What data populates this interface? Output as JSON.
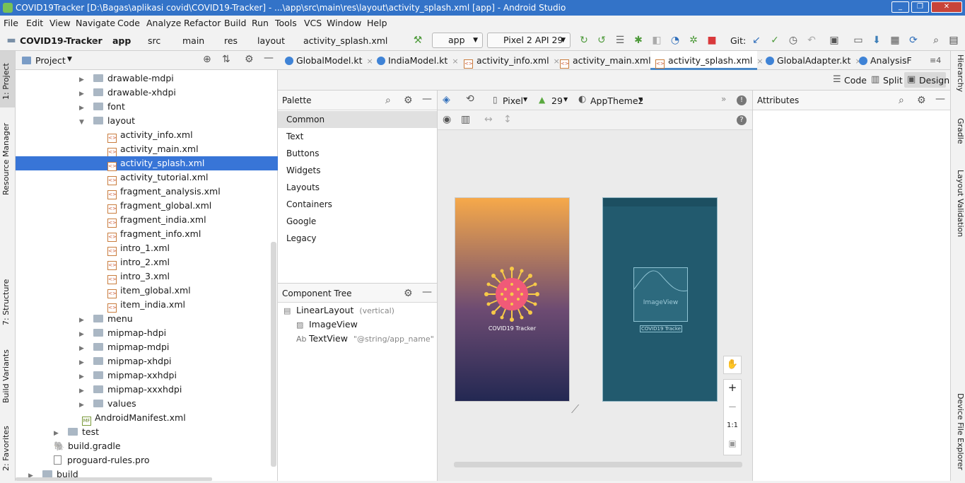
{
  "window": {
    "title": "COVID19Tracker [D:\\Bagas\\aplikasi covid\\COVID19-Tracker] - ...\\app\\src\\main\\res\\layout\\activity_splash.xml [app] - Android Studio"
  },
  "menu": [
    "File",
    "Edit",
    "View",
    "Navigate",
    "Code",
    "Analyze",
    "Refactor",
    "Build",
    "Run",
    "Tools",
    "VCS",
    "Window",
    "Help"
  ],
  "breadcrumb": [
    "COVID19-Tracker",
    "app",
    "src",
    "main",
    "res",
    "layout",
    "activity_splash.xml"
  ],
  "toolbar": {
    "run_config": "app",
    "device": "Pixel 2 API 29",
    "git_label": "Git:"
  },
  "left_tabs": [
    "1: Project",
    "Resource Manager",
    "7: Structure",
    "Build Variants",
    "2: Favorites"
  ],
  "right_tabs": [
    "Hierarchy",
    "Gradle",
    "Layout Validation",
    "Device File Explorer"
  ],
  "project": {
    "header": "Project",
    "tree": [
      {
        "label": "drawable-mdpi",
        "type": "folder",
        "level": 1,
        "expanded": false
      },
      {
        "label": "drawable-xhdpi",
        "type": "folder",
        "level": 1,
        "expanded": false
      },
      {
        "label": "font",
        "type": "folder",
        "level": 1,
        "expanded": false
      },
      {
        "label": "layout",
        "type": "folder",
        "level": 1,
        "expanded": true
      },
      {
        "label": "activity_info.xml",
        "type": "xml",
        "level": 2
      },
      {
        "label": "activity_main.xml",
        "type": "xml",
        "level": 2
      },
      {
        "label": "activity_splash.xml",
        "type": "xml",
        "level": 2,
        "selected": true
      },
      {
        "label": "activity_tutorial.xml",
        "type": "xml",
        "level": 2
      },
      {
        "label": "fragment_analysis.xml",
        "type": "xml",
        "level": 2
      },
      {
        "label": "fragment_global.xml",
        "type": "xml",
        "level": 2
      },
      {
        "label": "fragment_india.xml",
        "type": "xml",
        "level": 2
      },
      {
        "label": "fragment_info.xml",
        "type": "xml",
        "level": 2
      },
      {
        "label": "intro_1.xml",
        "type": "xml",
        "level": 2
      },
      {
        "label": "intro_2.xml",
        "type": "xml",
        "level": 2
      },
      {
        "label": "intro_3.xml",
        "type": "xml",
        "level": 2
      },
      {
        "label": "item_global.xml",
        "type": "xml",
        "level": 2
      },
      {
        "label": "item_india.xml",
        "type": "xml",
        "level": 2
      },
      {
        "label": "menu",
        "type": "folder",
        "level": 1,
        "expanded": false
      },
      {
        "label": "mipmap-hdpi",
        "type": "folder",
        "level": 1,
        "expanded": false
      },
      {
        "label": "mipmap-mdpi",
        "type": "folder",
        "level": 1,
        "expanded": false
      },
      {
        "label": "mipmap-xhdpi",
        "type": "folder",
        "level": 1,
        "expanded": false
      },
      {
        "label": "mipmap-xxhdpi",
        "type": "folder",
        "level": 1,
        "expanded": false
      },
      {
        "label": "mipmap-xxxhdpi",
        "type": "folder",
        "level": 1,
        "expanded": false
      },
      {
        "label": "values",
        "type": "folder",
        "level": 1,
        "expanded": false
      },
      {
        "label": "AndroidManifest.xml",
        "type": "manifest",
        "level": 0
      },
      {
        "label": "test",
        "type": "folder",
        "level": -1,
        "expanded": false
      },
      {
        "label": "build.gradle",
        "type": "gradle",
        "level": -2
      },
      {
        "label": "proguard-rules.pro",
        "type": "file",
        "level": -2
      },
      {
        "label": "build",
        "type": "folder",
        "level": -3,
        "expanded": false
      }
    ]
  },
  "tabs": [
    {
      "label": "GlobalModel.kt",
      "kind": "kt"
    },
    {
      "label": "IndiaModel.kt",
      "kind": "kt"
    },
    {
      "label": "activity_info.xml",
      "kind": "xml"
    },
    {
      "label": "activity_main.xml",
      "kind": "xml"
    },
    {
      "label": "activity_splash.xml",
      "kind": "xml",
      "active": true
    },
    {
      "label": "GlobalAdapter.kt",
      "kind": "kt"
    },
    {
      "label": "AnalysisF",
      "kind": "kt"
    }
  ],
  "tab_overflow": "≡4",
  "view_modes": {
    "code": "Code",
    "split": "Split",
    "design": "Design"
  },
  "palette": {
    "title": "Palette",
    "categories": [
      "Common",
      "Text",
      "Buttons",
      "Widgets",
      "Layouts",
      "Containers",
      "Google",
      "Legacy"
    ]
  },
  "design_toolbar": {
    "device": "Pixel",
    "api": "29",
    "theme": "AppTheme2"
  },
  "component_tree": {
    "title": "Component Tree",
    "items": [
      {
        "label": "LinearLayout",
        "hint": "(vertical)",
        "level": 0
      },
      {
        "label": "ImageView",
        "hint": "",
        "level": 1
      },
      {
        "label": "TextView",
        "hint": "\"@string/app_name\"",
        "level": 1
      }
    ]
  },
  "preview": {
    "app_title": "COVID19 Tracker",
    "blueprint_image": "ImageView",
    "blueprint_text": "COVID19 Tracke"
  },
  "zoom": {
    "pan": "✋",
    "in": "+",
    "out": "−",
    "ratio": "1:1"
  },
  "attributes": {
    "title": "Attributes"
  }
}
